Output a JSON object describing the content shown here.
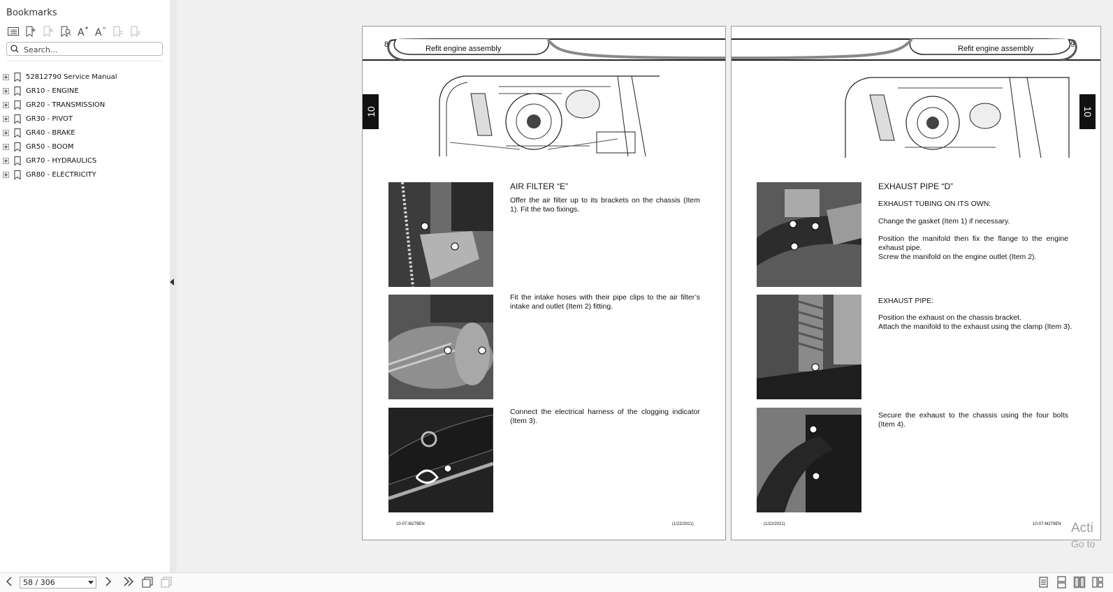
{
  "sidebar": {
    "title": "Bookmarks",
    "search_placeholder": "Search...",
    "toolbar_icons": [
      "bookmark-list-icon",
      "add-bookmark-icon",
      "delete-bookmark-icon",
      "find-bookmark-icon",
      "increase-font-icon",
      "decrease-font-icon",
      "expand-bookmark-icon",
      "collapse-bookmark-icon"
    ],
    "items": [
      {
        "label": "52812790 Service Manual"
      },
      {
        "label": "GR10 - ENGINE"
      },
      {
        "label": "GR20 - TRANSMISSION"
      },
      {
        "label": "GR30 - PIVOT"
      },
      {
        "label": "GR40 - BRAKE"
      },
      {
        "label": "GR50 - BOOM"
      },
      {
        "label": "GR70 - HYDRAULICS"
      },
      {
        "label": "GR80 - ELECTRICITY"
      }
    ]
  },
  "pages": {
    "left": {
      "page_number": "8",
      "header_title": "Refit engine assembly",
      "tab_label": "10",
      "heading": "AIR FILTER “E”",
      "para1": "Offer the air filter up to its brackets on the chassis (Item 1). Fit the two fixings.",
      "para2": "Fit the intake hoses with their pipe clips to the air filter’s intake and outlet (Item 2) fitting.",
      "para3": "Connect the electrical harness of the clogging indicator (Item 3).",
      "footer_left": "10-07-M279EN",
      "footer_right": "(1/22/2021)"
    },
    "right": {
      "page_number": "9",
      "header_title": "Refit engine assembly",
      "tab_label": "10",
      "heading": "EXHAUST PIPE “D”",
      "sub1": "EXHAUST TUBING ON ITS OWN:",
      "para1": "Change the gasket (Item 1) if necessary.",
      "para2": "Position the manifold then fix the flange to the engine exhaust pipe.",
      "para3": "Screw the manifold on the engine outlet (Item 2).",
      "sub2": "EXHAUST PIPE:",
      "para4": "Position the exhaust on the chassis bracket.",
      "para5": "Attach the manifold to the exhaust using the clamp (Item 3).",
      "para6": "Secure the exhaust to the chassis using the four bolts (Item 4).",
      "footer_left": "(1/22/2021)",
      "footer_right": "10-07-M279EN"
    }
  },
  "watermark": {
    "line1": "Acti",
    "line2": "Go to"
  },
  "bottombar": {
    "page_display": "58 / 306",
    "nav_icons": [
      "previous-page-icon",
      "next-page-icon",
      "last-page-icon",
      "copy-page-icon",
      "extract-page-icon"
    ],
    "view_icons": [
      "single-page-view-icon",
      "continuous-view-icon",
      "facing-view-icon",
      "cover-view-icon"
    ]
  }
}
